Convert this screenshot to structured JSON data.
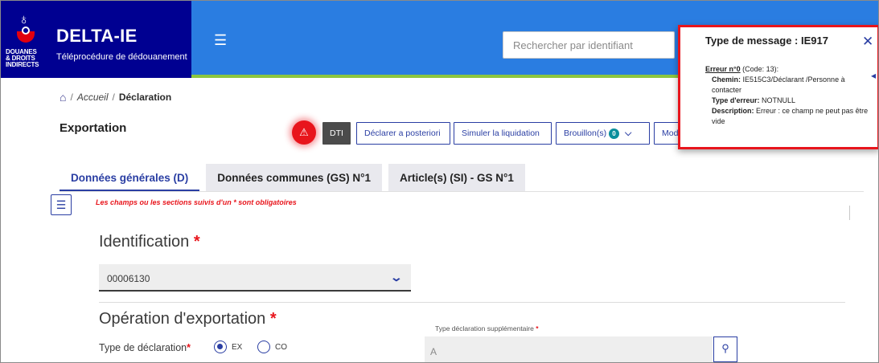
{
  "header": {
    "logo_text": "DOUANES\n& DROITS\nINDIRECTS",
    "app_title": "DELTA-IE",
    "app_subtitle": "Téléprocédure de dédouanement",
    "search_placeholder": "Rechercher par identifiant",
    "colors": {
      "brand": "#000091",
      "bar": "#2a7de1",
      "accent_line": "#8cc63f"
    }
  },
  "breadcrumb": {
    "home_icon": "home-icon",
    "items": [
      "Accueil",
      "Déclaration"
    ]
  },
  "page": {
    "title": "Exportation"
  },
  "toolbar": {
    "alert_icon": "warning-icon",
    "dti": "DTI",
    "declarer": "Déclarer a posteriori",
    "simuler": "Simuler la liquidation",
    "brouillons": "Brouillon(s)",
    "brouillons_count": "0",
    "mod": "Mod"
  },
  "tabs": [
    {
      "label": "Données générales (D)",
      "active": true
    },
    {
      "label": "Données communes (GS) N°1",
      "active": false
    },
    {
      "label": "Article(s) (SI) - GS N°1",
      "active": false
    }
  ],
  "form": {
    "mandatory_note": "Les champs ou les sections suivis d'un * sont obligatoires",
    "identification": {
      "title": "Identification",
      "value": "00006130"
    },
    "operation": {
      "title": "Opération d'exportation",
      "type_label": "Type de déclaration",
      "options": [
        {
          "label": "EX",
          "selected": true
        },
        {
          "label": "CO",
          "selected": false
        }
      ],
      "supp_label": "Type déclaration supplémentaire",
      "supp_value": "A"
    },
    "star": "*"
  },
  "toast": {
    "title": "Type de message : IE917",
    "close": "✕",
    "error_label": "Erreur n°0",
    "error_code": " (Code: 13):",
    "chemin_label": "Chemin:",
    "chemin_value": " IE515C3/Déclarant /Personne à contacter",
    "type_label": "Type d'erreur:",
    "type_value": " NOTNULL",
    "desc_label": "Description:",
    "desc_value": " Erreur : ce champ ne peut pas être vide",
    "border_color": "#e8151c"
  }
}
